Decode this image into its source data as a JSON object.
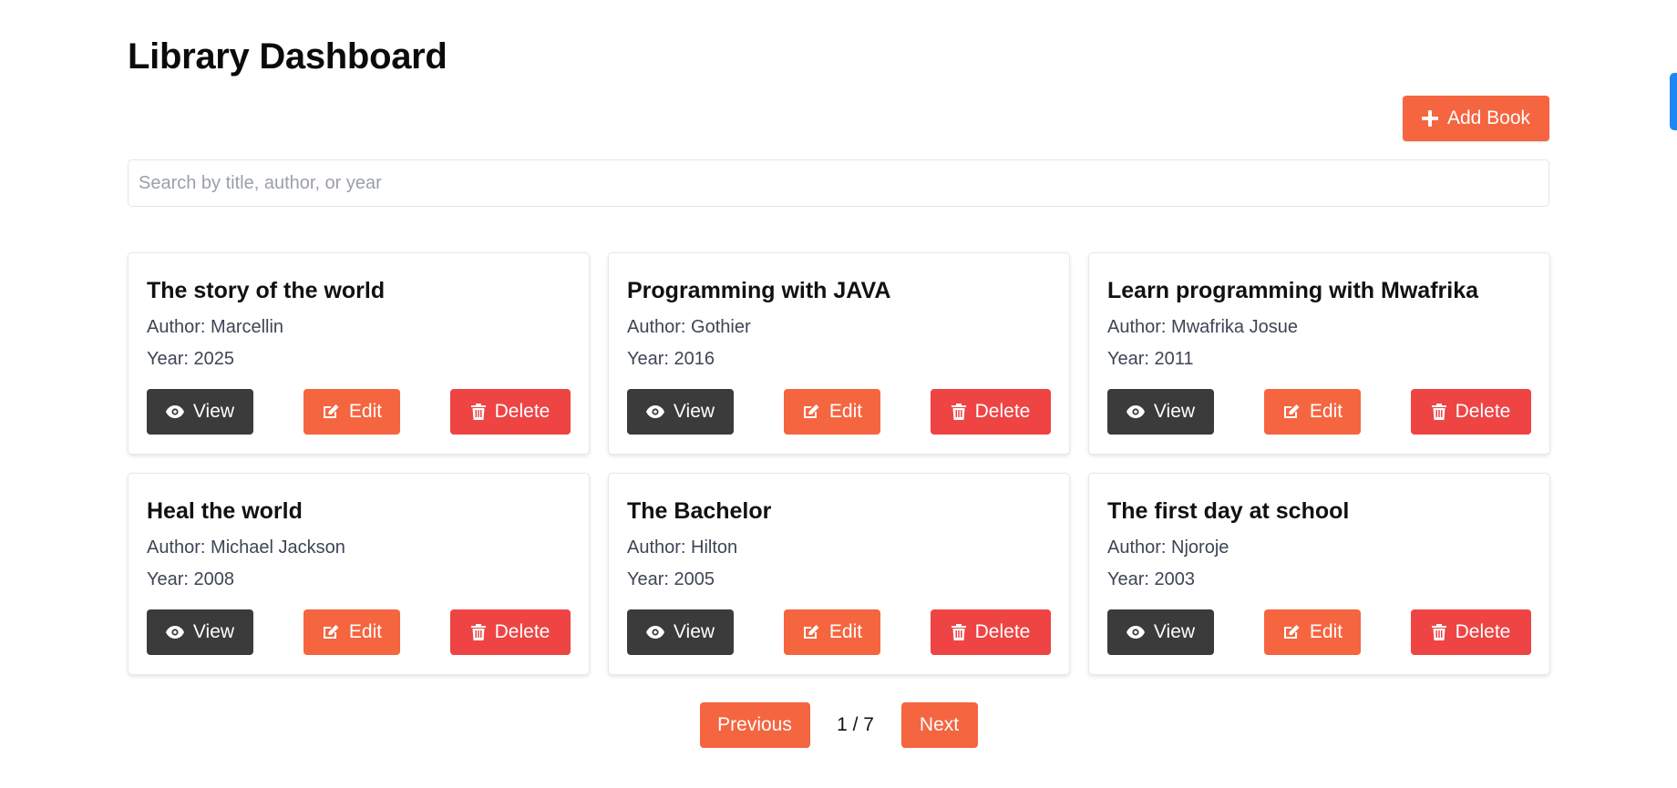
{
  "page": {
    "title": "Library Dashboard"
  },
  "toolbar": {
    "add_label": "Add Book",
    "add_icon": "plus-icon"
  },
  "search": {
    "placeholder": "Search by title, author, or year",
    "value": ""
  },
  "buttons": {
    "view": "View",
    "edit": "Edit",
    "delete": "Delete"
  },
  "books": [
    {
      "title": "The story of the world",
      "author": "Author: Marcellin",
      "year": "Year: 2025"
    },
    {
      "title": "Programming with JAVA",
      "author": "Author: Gothier",
      "year": "Year: 2016"
    },
    {
      "title": "Learn programming with Mwafrika",
      "author": "Author: Mwafrika Josue",
      "year": "Year: 2011"
    },
    {
      "title": "Heal the world",
      "author": "Author: Michael Jackson",
      "year": "Year: 2008"
    },
    {
      "title": "The Bachelor",
      "author": "Author: Hilton",
      "year": "Year: 2005"
    },
    {
      "title": "The first day at school",
      "author": "Author: Njoroje",
      "year": "Year: 2003"
    }
  ],
  "pagination": {
    "previous": "Previous",
    "indicator": "1 / 7",
    "next": "Next"
  },
  "colors": {
    "accent": "#f56540",
    "danger": "#ee4444",
    "dark": "#3b3b3b",
    "edge_tab": "#1e88f0"
  }
}
